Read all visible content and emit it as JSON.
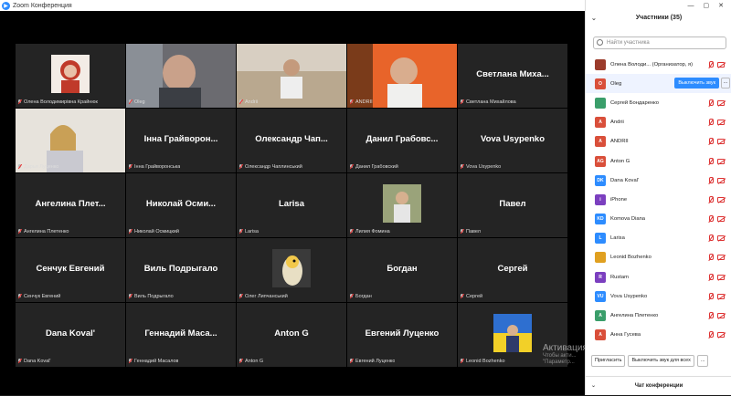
{
  "window": {
    "title": "Zoom Конференция",
    "controls": [
      "—",
      "▢",
      "✕"
    ]
  },
  "participants_panel": {
    "title": "Участники (35)",
    "search_placeholder": "Найти участника",
    "rows": [
      {
        "initials": "",
        "name": "Олена Володи...  (Организатор, я)",
        "color": "#9b3b2b",
        "photo": true
      },
      {
        "initials": "O",
        "name": "Oleg",
        "color": "#d94f3a",
        "mute_button": "Выключить звук",
        "selected": true
      },
      {
        "initials": "",
        "name": "Сергей Бондаренко",
        "color": "#3a9e6a"
      },
      {
        "initials": "A",
        "name": "Andrii",
        "color": "#d94f3a"
      },
      {
        "initials": "A",
        "name": "ANDRII",
        "color": "#d94f3a"
      },
      {
        "initials": "AG",
        "name": "Anton G",
        "color": "#d94f3a"
      },
      {
        "initials": "DK",
        "name": "Dana Koval'",
        "color": "#2d8cff"
      },
      {
        "initials": "i",
        "name": "iPhone",
        "color": "#7b3fbf"
      },
      {
        "initials": "KD",
        "name": "Komova Diana",
        "color": "#2d8cff"
      },
      {
        "initials": "L",
        "name": "Larisa",
        "color": "#2d8cff"
      },
      {
        "initials": "",
        "name": "Leonid Bozhenko",
        "color": "#e0a020"
      },
      {
        "initials": "R",
        "name": "Rustam",
        "color": "#7b3fbf"
      },
      {
        "initials": "VU",
        "name": "Vova Usypenko",
        "color": "#2d8cff"
      },
      {
        "initials": "A",
        "name": "Ангелина Плетенко",
        "color": "#3a9e6a"
      },
      {
        "initials": "A",
        "name": "Анна Гусева",
        "color": "#d94f3a"
      }
    ],
    "invite_label": "Пригласить",
    "mute_all_label": "Выключить звук для всех",
    "more_label": "...",
    "chat_label": "Чат конференции"
  },
  "tiles": [
    {
      "big": "",
      "cap": "Олена Володимирівна Крайнюк",
      "photo": "woman-red"
    },
    {
      "big": "",
      "cap": "Oleg",
      "photo": "video-man",
      "active": true
    },
    {
      "big": "",
      "cap": "Andrii",
      "photo": "video-room"
    },
    {
      "big": "",
      "cap": "ANDRII",
      "photo": "video-orange"
    },
    {
      "big": "Светлана  Миха...",
      "cap": "Светлана Михайлова"
    },
    {
      "big": "",
      "cap": "Дарья Луценко",
      "photo": "video-woman"
    },
    {
      "big": "Інна  Грайворон...",
      "cap": "Інна Грайворонська"
    },
    {
      "big": "Олександр  Чап...",
      "cap": "Олександр Чаплинський"
    },
    {
      "big": "Данил  Грабовс...",
      "cap": "Данил Грабовский"
    },
    {
      "big": "Vova  Usypenko",
      "cap": "Vova Usypenko"
    },
    {
      "big": "Ангелина  Плет...",
      "cap": "Ангелина Плетенко"
    },
    {
      "big": "Николай  Осми...",
      "cap": "Николай Осмицкий"
    },
    {
      "big": "Larisa",
      "cap": "Larisa"
    },
    {
      "big": "",
      "cap": "Лилия Фомина",
      "photo": "small-person"
    },
    {
      "big": "Павел",
      "cap": "Павел"
    },
    {
      "big": "Сенчук  Евгений",
      "cap": "Сенчук Евгений"
    },
    {
      "big": "Виль  Подрыгало",
      "cap": "Виль Подрыгало"
    },
    {
      "big": "",
      "cap": "Олег Липчанський",
      "photo": "bird"
    },
    {
      "big": "Богдан",
      "cap": "Богдан"
    },
    {
      "big": "Сергей",
      "cap": "Сергей"
    },
    {
      "big": "Dana  Koval'",
      "cap": "Dana Koval'"
    },
    {
      "big": "Геннадий  Маса...",
      "cap": "Геннадий Масалов"
    },
    {
      "big": "Anton  G",
      "cap": "Anton G"
    },
    {
      "big": "Евгений  Луценко",
      "cap": "Евгений Луценко"
    },
    {
      "big": "",
      "cap": "Leonid Bozhenko",
      "photo": "flag"
    }
  ],
  "watermark": {
    "line1": "Активация Windows",
    "line2": "Чтобы акти...",
    "line3": "\"Параметр..."
  }
}
